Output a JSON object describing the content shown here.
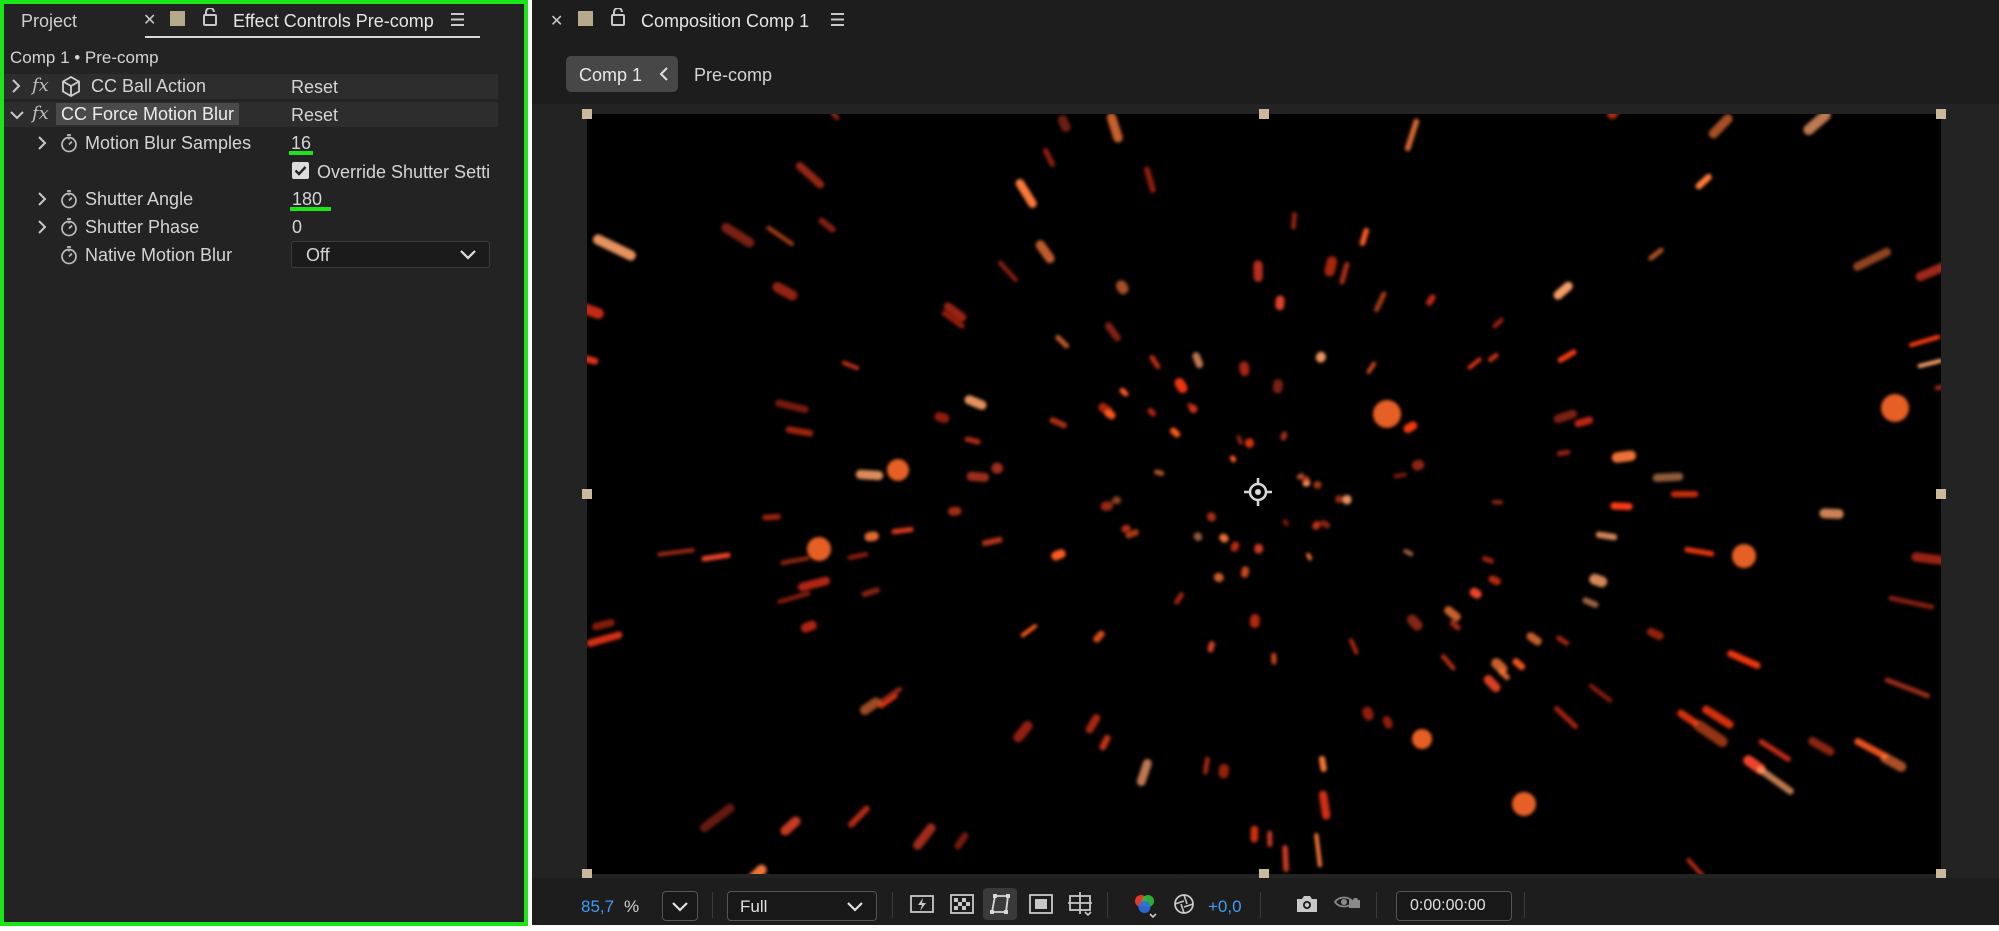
{
  "left_panel": {
    "tabs": {
      "project": "Project",
      "effect_controls": "Effect Controls Pre-comp"
    },
    "breadcrumb": "Comp 1 • Pre-comp",
    "effects": [
      {
        "name": "CC Ball Action",
        "reset": "Reset"
      },
      {
        "name": "CC Force Motion Blur",
        "reset": "Reset"
      }
    ],
    "properties": {
      "motion_blur_samples": {
        "label": "Motion Blur Samples",
        "value": "16"
      },
      "override_shutter": {
        "label": "Override Shutter Setti",
        "checked": true
      },
      "shutter_angle": {
        "label": "Shutter Angle",
        "value": "180"
      },
      "shutter_phase": {
        "label": "Shutter Phase",
        "value": "0"
      },
      "native_motion_blur": {
        "label": "Native Motion Blur",
        "value": "Off"
      }
    },
    "fx_glyph": "fx",
    "highlight_color": "#19e519"
  },
  "right_panel": {
    "tab_title": "Composition Comp 1",
    "breadcrumb": {
      "current": "Comp 1",
      "child": "Pre-comp"
    },
    "toolbar": {
      "zoom": "85,7",
      "zoom_unit": "%",
      "resolution": "Full",
      "exposure": "+0,0",
      "timecode": "0:00:00:00"
    }
  },
  "icons": {
    "close": "close-icon",
    "menu": "hamburger-menu-icon",
    "lock": "lock-icon",
    "stopwatch": "stopwatch-icon",
    "chevron": "chevron-icon",
    "camera": "snapshot-camera-icon"
  }
}
